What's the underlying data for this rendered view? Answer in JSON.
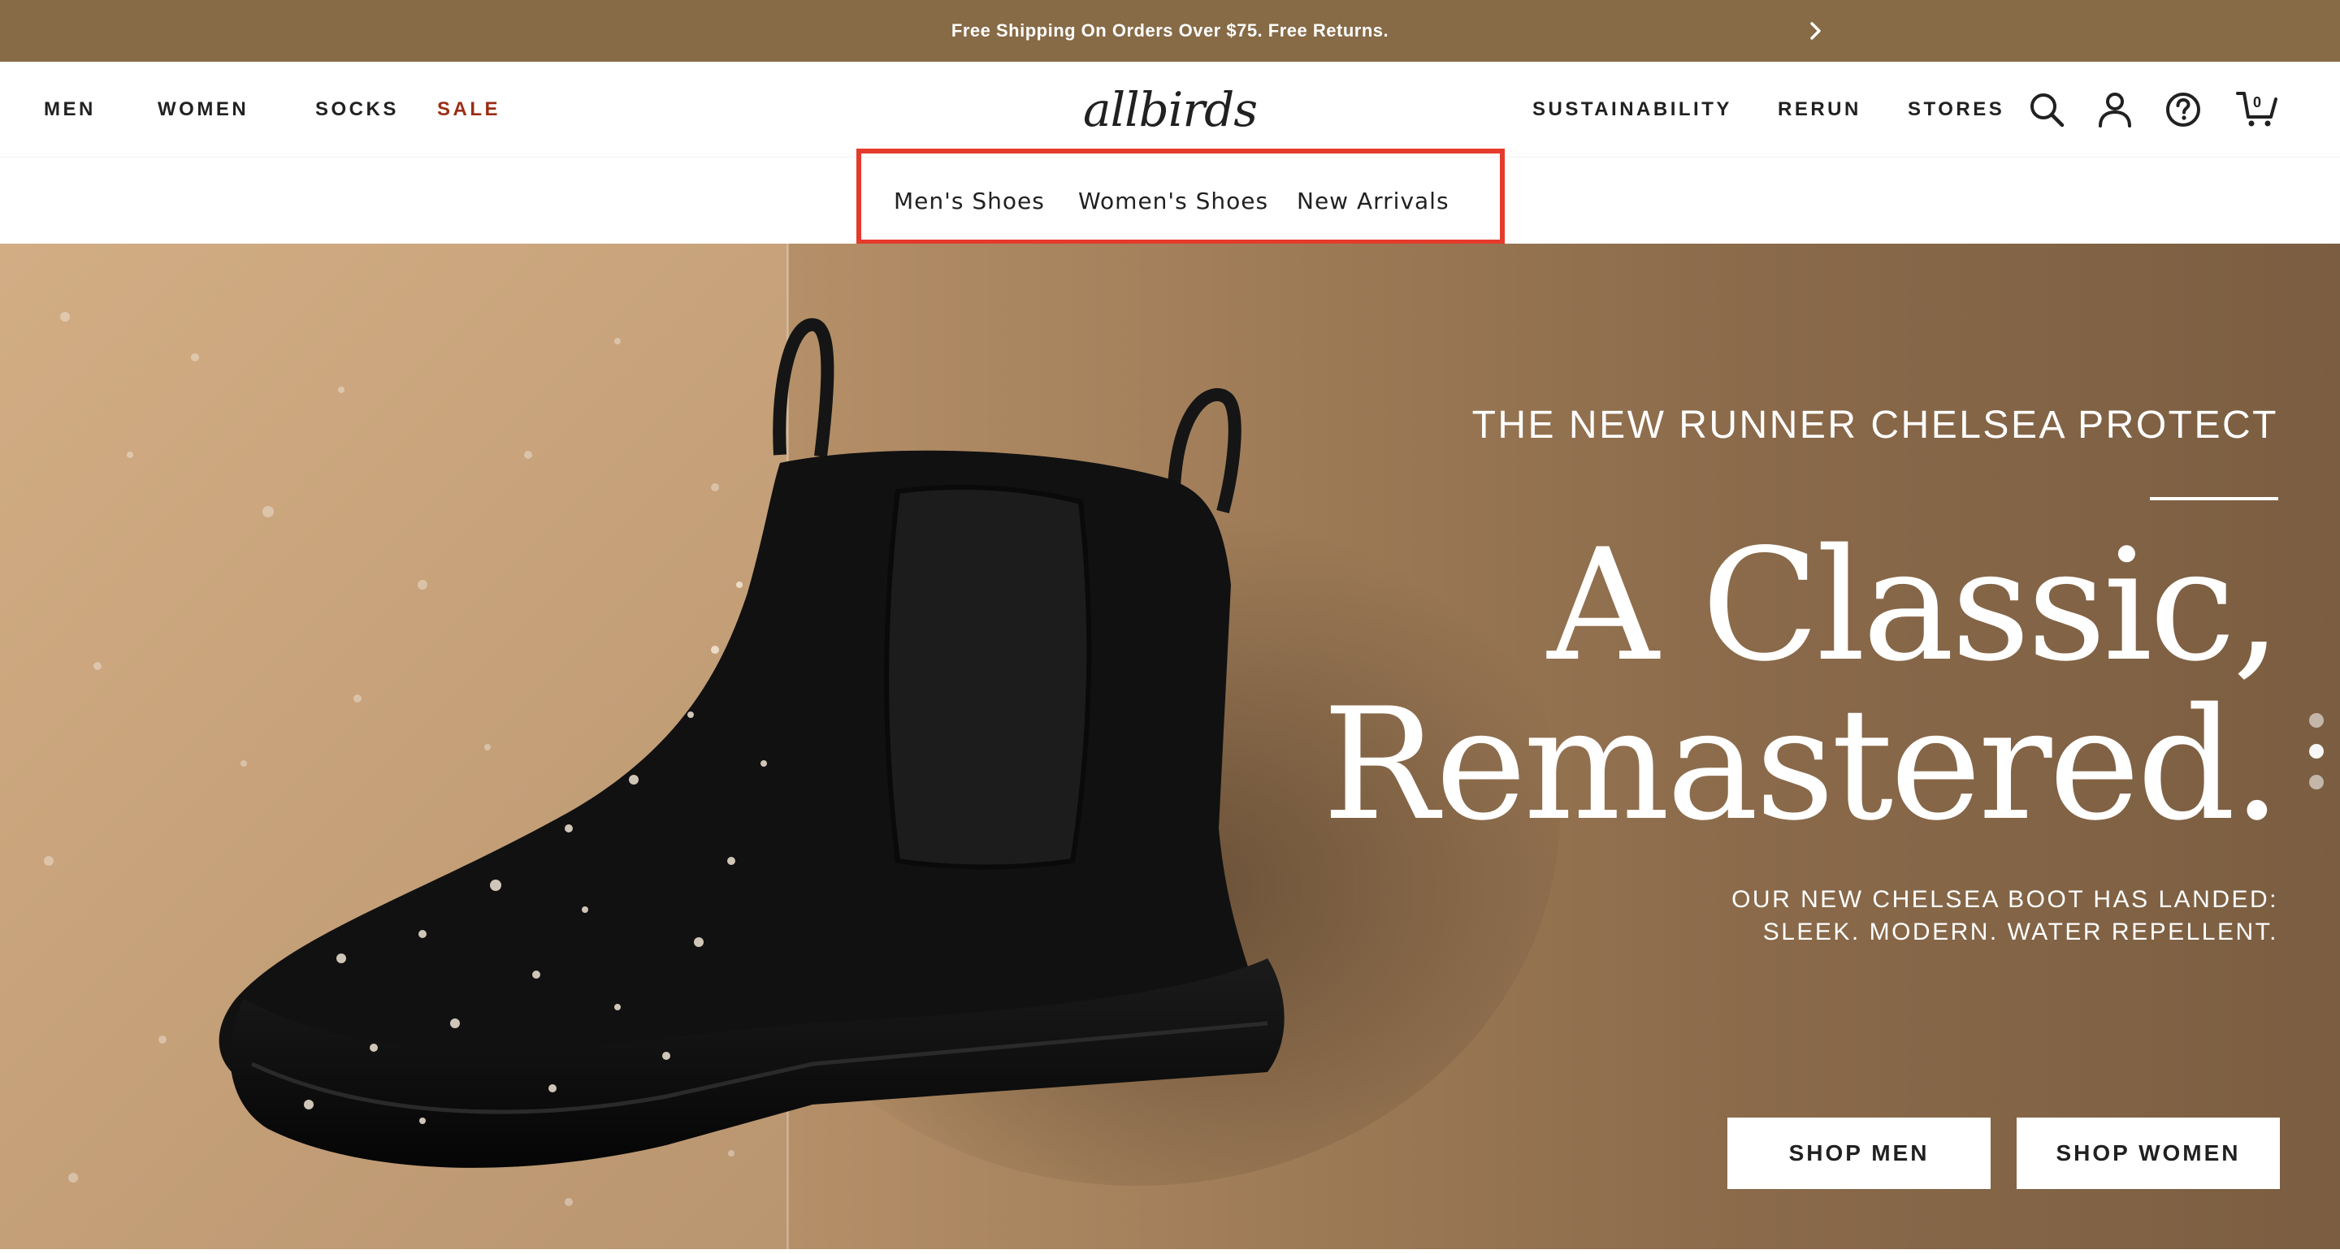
{
  "announcement": {
    "text": "Free Shipping On Orders Over $75. Free Returns.",
    "next_icon": "chevron-right-icon"
  },
  "nav": {
    "left_links": [
      "MEN",
      "WOMEN",
      "SOCKS",
      "SALE"
    ],
    "logo": "allbirds",
    "right_links": [
      "SUSTAINABILITY",
      "RERUN",
      "STORES"
    ],
    "icons": [
      "search-icon",
      "account-icon",
      "help-icon",
      "cart-icon"
    ],
    "cart_count": "0"
  },
  "subnav": {
    "links": [
      "Men's Shoes",
      "Women's Shoes",
      "New Arrivals"
    ]
  },
  "hero": {
    "eyebrow": "THE NEW RUNNER CHELSEA PROTECT",
    "headline_line1": "A Classic,",
    "headline_line2": "Remastered.",
    "sub_line1": "OUR NEW CHELSEA BOOT HAS LANDED:",
    "sub_line2": "SLEEK. MODERN. WATER REPELLENT.",
    "cta_men": "SHOP MEN",
    "cta_women": "SHOP WOMEN",
    "carousel_dots": 3,
    "active_dot": 1
  },
  "colors": {
    "announcement_bg": "#876a46",
    "sale_red": "#9b2d16",
    "highlight_box": "#e53b2c",
    "hero_text": "#ffffff"
  }
}
